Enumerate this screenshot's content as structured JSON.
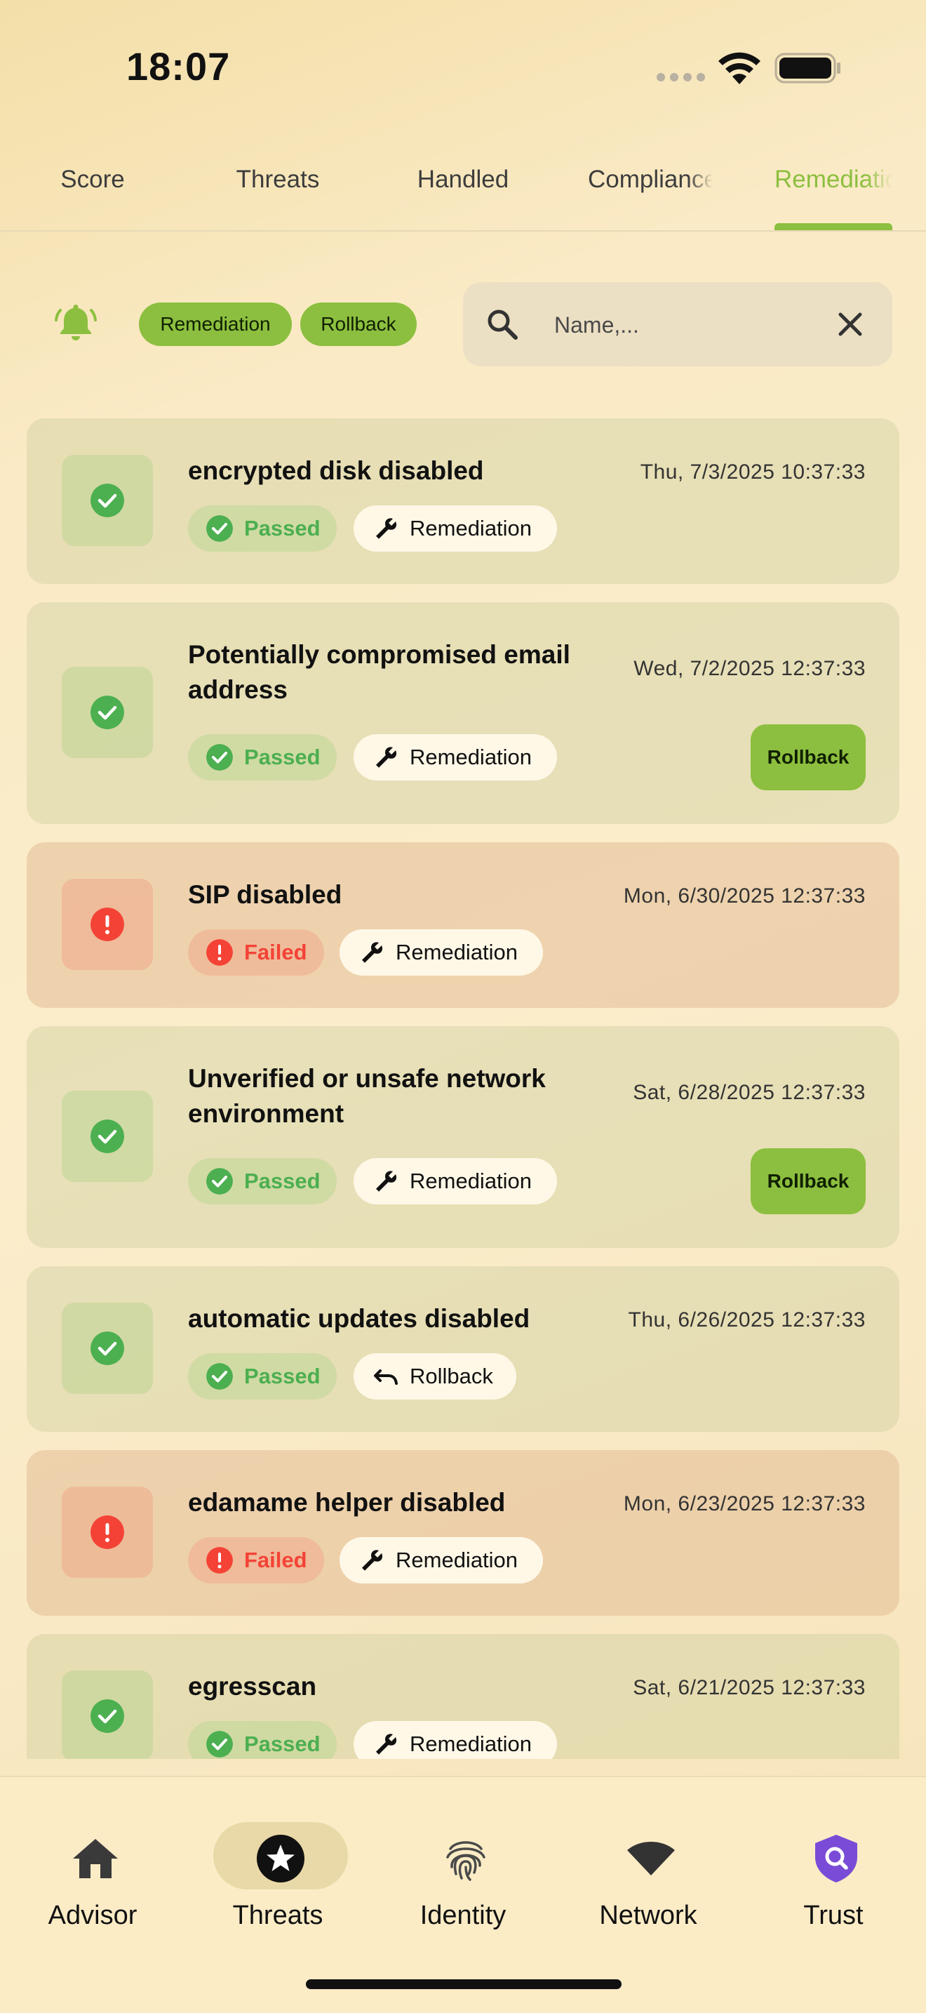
{
  "status_bar": {
    "time": "18:07"
  },
  "tabs": [
    {
      "label": "Score",
      "active": false
    },
    {
      "label": "Threats",
      "active": false
    },
    {
      "label": "Handled",
      "active": false
    },
    {
      "label": "Compliance",
      "active": false
    },
    {
      "label": "Remediation",
      "active": true
    }
  ],
  "filters": {
    "chips": [
      "Remediation",
      "Rollback"
    ],
    "search_placeholder": "Name,..."
  },
  "cards": [
    {
      "title": "encrypted disk disabled",
      "date": "Thu, 7/3/2025 10:37:33",
      "status": "Passed",
      "action": "Remediation",
      "rollback_button": ""
    },
    {
      "title": "Potentially compromised email address",
      "date": "Wed, 7/2/2025 12:37:33",
      "status": "Passed",
      "action": "Remediation",
      "rollback_button": "Rollback"
    },
    {
      "title": "SIP disabled",
      "date": "Mon, 6/30/2025 12:37:33",
      "status": "Failed",
      "action": "Remediation",
      "rollback_button": ""
    },
    {
      "title": "Unverified or unsafe network environment",
      "date": "Sat, 6/28/2025 12:37:33",
      "status": "Passed",
      "action": "Remediation",
      "rollback_button": "Rollback"
    },
    {
      "title": "automatic updates disabled",
      "date": "Thu, 6/26/2025 12:37:33",
      "status": "Passed",
      "action": "Rollback",
      "rollback_button": ""
    },
    {
      "title": "edamame helper disabled",
      "date": "Mon, 6/23/2025 12:37:33",
      "status": "Failed",
      "action": "Remediation",
      "rollback_button": ""
    },
    {
      "title": "egresscan",
      "date": "Sat, 6/21/2025 12:37:33",
      "status": "Passed",
      "action": "Remediation",
      "rollback_button": ""
    }
  ],
  "bottom_nav": [
    {
      "label": "Advisor",
      "icon": "home-icon",
      "active": false
    },
    {
      "label": "Threats",
      "icon": "star-badge-icon",
      "active": true
    },
    {
      "label": "Identity",
      "icon": "fingerprint-icon",
      "active": false
    },
    {
      "label": "Network",
      "icon": "wifi-icon",
      "active": false
    },
    {
      "label": "Trust",
      "icon": "shield-search-icon",
      "active": false
    }
  ],
  "colors": {
    "accent": "#8cbf3f",
    "passed": "#4caf50",
    "failed": "#f44336",
    "trust_icon": "#7a4bd6"
  }
}
